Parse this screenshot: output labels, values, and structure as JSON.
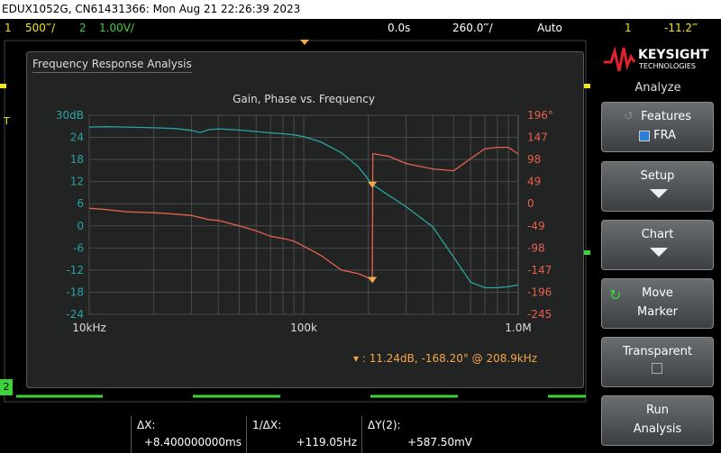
{
  "window": {
    "title": "EDUX1052G, CN61431366: Mon Aug 21 22:26:39 2023"
  },
  "status": {
    "ch1_num": "1",
    "ch1_scale": "500‴/",
    "ch2_num": "2",
    "ch2_scale": "1.00V/",
    "time_delay": "0.0s",
    "time_scale": "260.0‴/",
    "trigger_mode": "Auto",
    "trig_ch": "1",
    "trig_level": "-11.2‴"
  },
  "fra": {
    "panel_title": "Frequency Response Analysis",
    "marker_readout": "11.24dB, -168.20° @ 208.9kHz"
  },
  "chart_data": {
    "type": "line",
    "title": "Gain, Phase vs. Frequency",
    "x_scale": "log",
    "x_range": [
      10000,
      1000000
    ],
    "x_ticks": [
      "10kHz",
      "100k",
      "1.0M"
    ],
    "y_left_ticks": [
      "30dB",
      "24",
      "18",
      "12",
      "6",
      "0",
      "-6",
      "-12",
      "-18",
      "-24"
    ],
    "y_left_range": [
      -24,
      30
    ],
    "y_right_ticks": [
      "196°",
      "147",
      "98",
      "49",
      "0",
      "-49",
      "-98",
      "-147",
      "-196",
      "-245"
    ],
    "y_right_range": [
      -245,
      196
    ],
    "grid": true,
    "colors": {
      "gain": "#2aa3a3",
      "phase": "#e8604e",
      "axis_left": "#2aa3a3",
      "axis_right": "#e8604e",
      "marker": "#f5a64b"
    },
    "series": [
      {
        "axis": "left",
        "x": [
          10000,
          12000,
          15000,
          20000,
          25000,
          30000,
          33000,
          36000,
          40000,
          50000,
          60000,
          70000,
          80000,
          90000,
          100000,
          120000,
          150000,
          180000,
          208900,
          250000,
          300000,
          400000,
          500000,
          600000,
          700000,
          800000,
          900000,
          1000000
        ],
        "y": [
          26.8,
          26.9,
          26.8,
          26.6,
          26.4,
          25.9,
          25.3,
          26.1,
          26.3,
          26.0,
          25.6,
          25.2,
          25.0,
          24.7,
          24.2,
          22.8,
          19.8,
          16.0,
          11.24,
          8.2,
          5.2,
          -0.3,
          -8.5,
          -15.3,
          -16.8,
          -16.8,
          -16.5,
          -16.0
        ]
      },
      {
        "axis": "right",
        "x": [
          10000,
          12000,
          15000,
          20000,
          25000,
          30000,
          36000,
          40000,
          50000,
          60000,
          70000,
          80000,
          90000,
          100000,
          120000,
          150000,
          180000,
          208900,
          210000,
          250000,
          300000,
          400000,
          500000,
          600000,
          700000,
          800000,
          900000,
          1000000
        ],
        "y": [
          -10,
          -13,
          -18,
          -20,
          -23,
          -26,
          -35,
          -37,
          -49,
          -60,
          -72,
          -77,
          -83,
          -94,
          -114,
          -147,
          -155,
          -168.2,
          111,
          105,
          89,
          77,
          73,
          100,
          122,
          125,
          125,
          110
        ]
      }
    ],
    "markers": [
      {
        "series": 0,
        "x": 208900,
        "y": 11.24
      },
      {
        "series": 1,
        "x": 208900,
        "y": -168.2
      }
    ]
  },
  "brand": {
    "name": "KEYSIGHT",
    "sub": "TECHNOLOGIES"
  },
  "softkeys": {
    "menu_title": "Analyze",
    "features": {
      "label": "Features",
      "value": "FRA"
    },
    "setup": {
      "label": "Setup"
    },
    "chart": {
      "label": "Chart"
    },
    "move_marker": {
      "line1": "Move",
      "line2": "Marker"
    },
    "transparent": {
      "label": "Transparent"
    },
    "run_analysis": {
      "line1": "Run",
      "line2": "Analysis"
    }
  },
  "readouts": {
    "dx_label": "ΔX:",
    "dx_value": "+8.400000000ms",
    "inv_dx_label": "1/ΔX:",
    "inv_dx_value": "+119.05Hz",
    "dy_label": "ΔY(2):",
    "dy_value": "+587.50mV"
  },
  "markers_side": {
    "ch2_tag": "2",
    "trig_tag": "T"
  }
}
